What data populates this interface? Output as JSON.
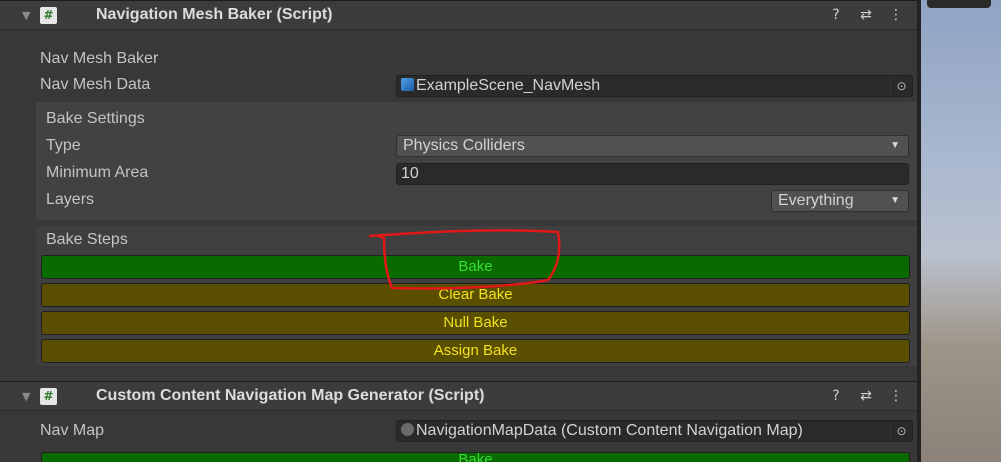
{
  "component1": {
    "title": "Navigation Mesh Baker (Script)",
    "script_icon": "#",
    "section_label": "Nav Mesh Baker",
    "nav_mesh_data": {
      "label": "Nav Mesh Data",
      "value": "ExampleScene_NavMesh",
      "icon": "navmesh-asset-icon"
    },
    "bake_settings": {
      "heading": "Bake Settings",
      "type": {
        "label": "Type",
        "value": "Physics Colliders"
      },
      "minimum_area": {
        "label": "Minimum Area",
        "value": "10"
      },
      "layers": {
        "label": "Layers",
        "value": "Everything"
      }
    },
    "bake_steps": {
      "heading": "Bake Steps",
      "buttons": [
        "Bake",
        "Clear Bake",
        "Null Bake",
        "Assign Bake"
      ]
    }
  },
  "component2": {
    "title": "Custom Content Navigation Map Generator (Script)",
    "script_icon": "#",
    "nav_map": {
      "label": "Nav Map",
      "value": "NavigationMapData (Custom Content Navigation Map)",
      "icon": "scriptable-object-icon"
    },
    "partial_button": "Bake"
  },
  "header_icons": {
    "help": "?",
    "presets": "⇄",
    "menu": "⋮"
  },
  "colors": {
    "bake_green": "#0a6a00",
    "bake_green_text": "#35e035",
    "olive": "#5a4f00",
    "olive_text": "#f0e020",
    "annotation_red": "#e01818"
  }
}
